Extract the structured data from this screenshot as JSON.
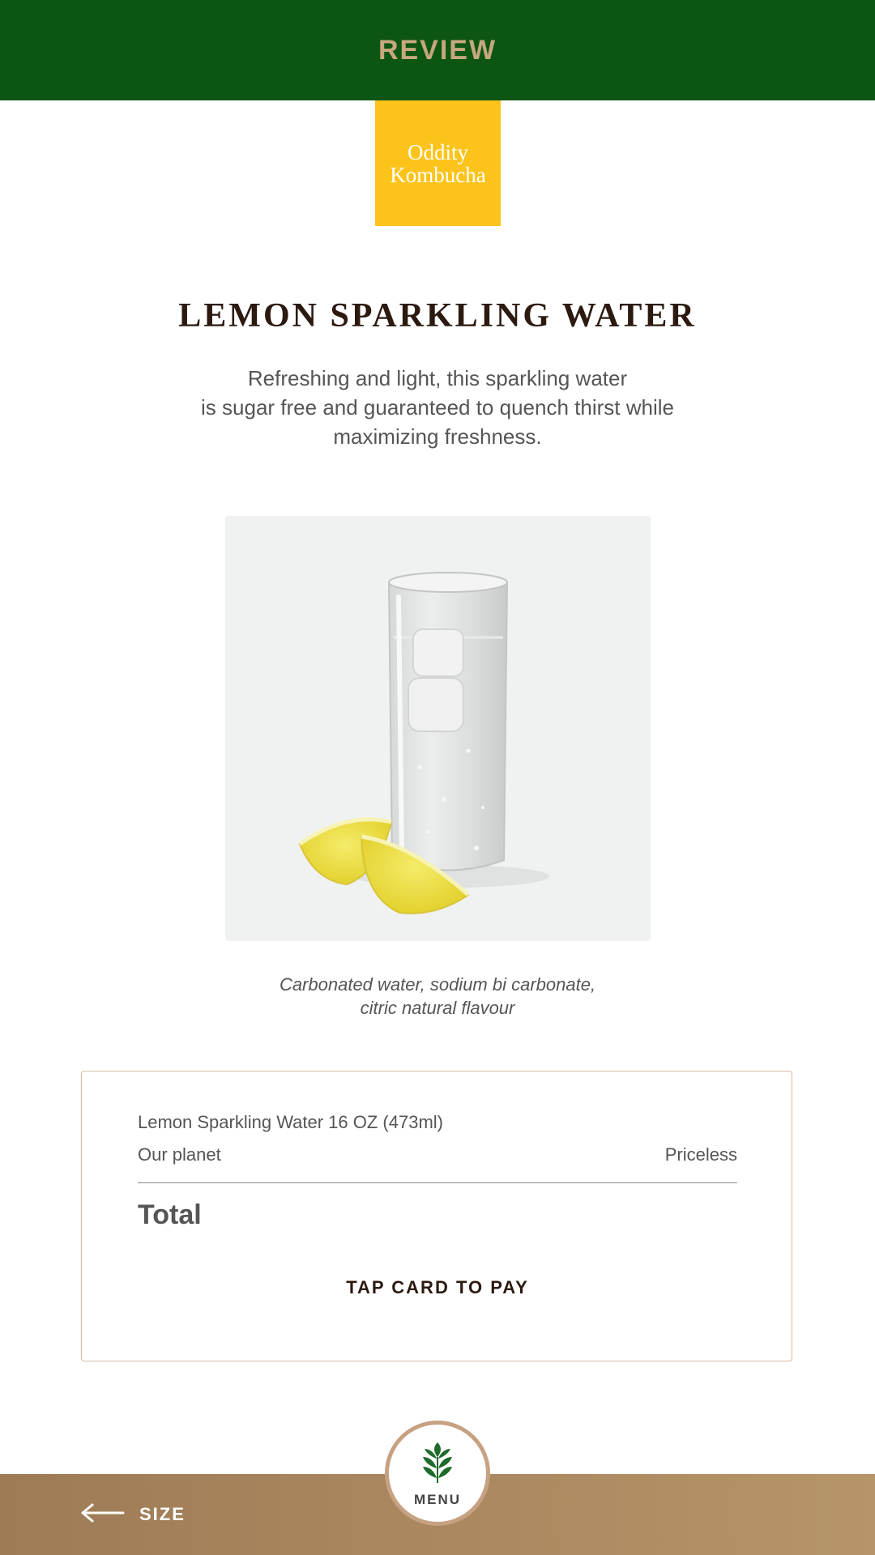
{
  "header": {
    "title": "REVIEW",
    "background": "#0d5512",
    "title_color": "#c6a87e"
  },
  "logo": {
    "line1": "Oddity",
    "line2": "Kombucha",
    "background": "#fcc31a"
  },
  "product": {
    "title": "LEMON SPARKLING WATER",
    "description": [
      "Refreshing and light, this sparkling water",
      "is sugar free and guaranteed to quench thirst while",
      "maximizing freshness."
    ],
    "ingredients": [
      "Carbonated water, sodium bi carbonate,",
      "citric natural flavour"
    ]
  },
  "order": {
    "item_name": "Lemon Sparkling Water 16 OZ (473ml)",
    "line_label": "Our planet",
    "line_value": "Priceless",
    "total_label": "Total",
    "pay_label": "TAP CARD TO PAY"
  },
  "footer": {
    "back_label": "SIZE",
    "back_icon": "arrow-left-icon",
    "menu_label": "MENU",
    "menu_icon": "leaf-sprout-icon"
  }
}
